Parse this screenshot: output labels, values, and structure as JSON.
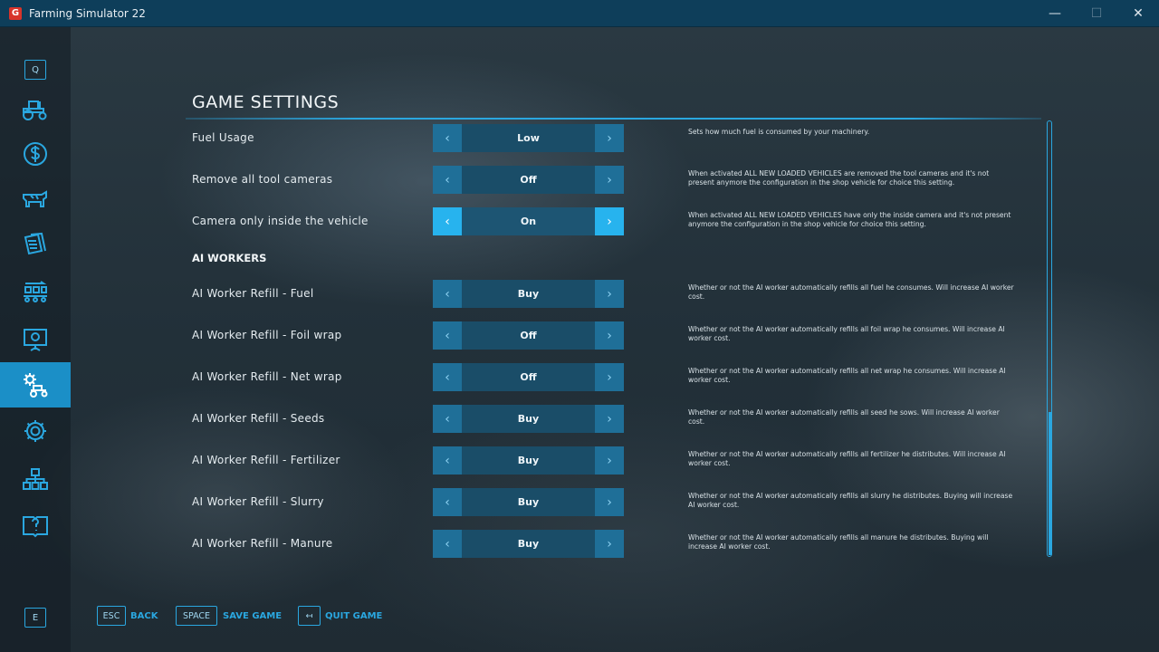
{
  "window": {
    "title": "Farming Simulator 22",
    "logo_letter": "G",
    "minimize": "—",
    "maximize": "☐",
    "close": "✕"
  },
  "sidebar": {
    "top_key": "Q",
    "bottom_key": "E",
    "items": [
      {
        "icon": "tractor-icon"
      },
      {
        "icon": "dollar-icon"
      },
      {
        "icon": "cow-icon"
      },
      {
        "icon": "contracts-icon"
      },
      {
        "icon": "production-icon"
      },
      {
        "icon": "presentation-icon"
      },
      {
        "icon": "game-settings-icon",
        "active": true
      },
      {
        "icon": "gear-icon"
      },
      {
        "icon": "hierarchy-icon"
      },
      {
        "icon": "help-book-icon"
      }
    ]
  },
  "page": {
    "title": "GAME SETTINGS",
    "section_ai": "AI WORKERS"
  },
  "arrows": {
    "left": "‹",
    "right": "›"
  },
  "settings": [
    {
      "label": "Fuel Usage",
      "value": "Low",
      "desc": "Sets how much fuel is consumed by your machinery."
    },
    {
      "label": "Remove all tool cameras",
      "value": "Off",
      "desc": "When activated ALL NEW LOADED VEHICLES are removed the tool cameras and it's not present anymore the configuration in the shop vehicle for choice this setting."
    },
    {
      "label": "Camera only inside the vehicle",
      "value": "On",
      "desc": "When activated ALL NEW LOADED VEHICLES have only the inside camera and it's not present anymore the configuration in the shop vehicle for choice this setting.",
      "focused": true
    },
    {
      "label": "AI Worker Refill - Fuel",
      "value": "Buy",
      "desc": "Whether or not the AI worker automatically refills all fuel he consumes. Will increase AI worker cost."
    },
    {
      "label": "AI Worker Refill - Foil wrap",
      "value": "Off",
      "desc": "Whether or not the AI worker automatically refills all foil wrap he consumes. Will increase AI worker cost."
    },
    {
      "label": "AI Worker Refill - Net wrap",
      "value": "Off",
      "desc": "Whether or not the AI worker automatically refills all net wrap he consumes. Will increase AI worker cost."
    },
    {
      "label": "AI Worker Refill - Seeds",
      "value": "Buy",
      "desc": "Whether or not the AI worker automatically refills all seed he sows. Will increase AI worker cost."
    },
    {
      "label": "AI Worker Refill - Fertilizer",
      "value": "Buy",
      "desc": "Whether or not the AI worker automatically refills all fertilizer he distributes. Will increase AI worker cost."
    },
    {
      "label": "AI Worker Refill - Slurry",
      "value": "Buy",
      "desc": "Whether or not the AI worker automatically refills all slurry he distributes. Buying will increase AI worker cost."
    },
    {
      "label": "AI Worker Refill - Manure",
      "value": "Buy",
      "desc": "Whether or not the AI worker automatically refills all manure he distributes. Buying will increase AI worker cost."
    }
  ],
  "footer": {
    "back_key": "ESC",
    "back_label": "BACK",
    "save_key": "SPACE",
    "save_label": "SAVE GAME",
    "quit_key": "↤",
    "quit_label": "QUIT GAME"
  },
  "colors": {
    "accent": "#2aa7e0",
    "titlebar": "#0e3e5a",
    "active_tab": "#1b8fc7"
  }
}
